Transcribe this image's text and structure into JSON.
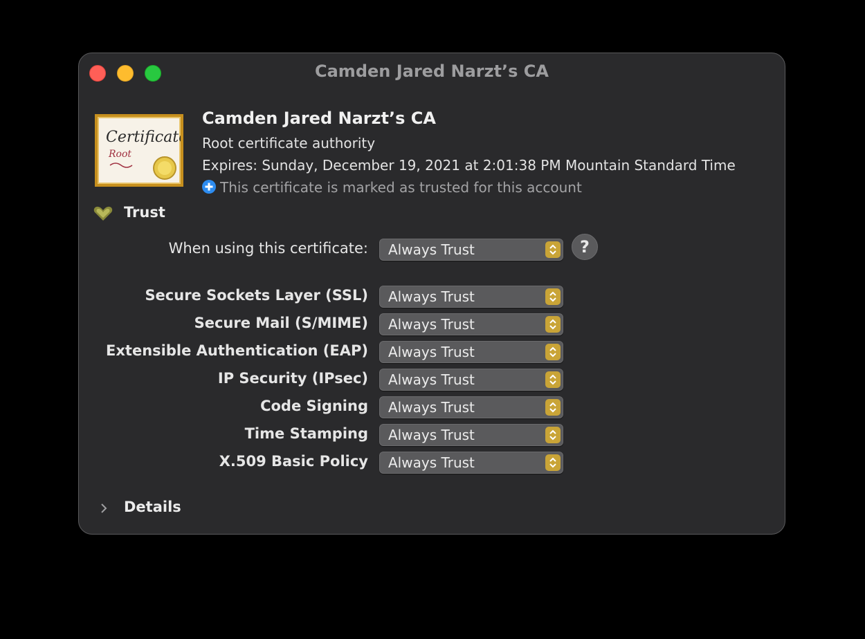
{
  "window": {
    "title": "Camden Jared Narzt’s CA"
  },
  "certificate": {
    "name": "Camden Jared Narzt’s CA",
    "kind": "Root certificate authority",
    "expires": "Expires: Sunday, December 19, 2021 at 2:01:38 PM Mountain Standard Time",
    "status": "This certificate is marked as trusted for this account",
    "icon_title": "Certificate",
    "icon_subtitle": "Root"
  },
  "trust": {
    "section_label": "Trust",
    "when_using": {
      "label": "When using this certificate:",
      "value": "Always Trust"
    },
    "help_label": "?",
    "policies": [
      {
        "label": "Secure Sockets Layer (SSL)",
        "value": "Always Trust"
      },
      {
        "label": "Secure Mail (S/MIME)",
        "value": "Always Trust"
      },
      {
        "label": "Extensible Authentication (EAP)",
        "value": "Always Trust"
      },
      {
        "label": "IP Security (IPsec)",
        "value": "Always Trust"
      },
      {
        "label": "Code Signing",
        "value": "Always Trust"
      },
      {
        "label": "Time Stamping",
        "value": "Always Trust"
      },
      {
        "label": "X.509 Basic Policy",
        "value": "Always Trust"
      }
    ]
  },
  "details": {
    "label": "Details"
  },
  "colors": {
    "accent_gold": "#c9a437",
    "status_blue": "#2d8cf0",
    "window_bg": "#2a2a2c"
  },
  "icons": {
    "status": "plus-circle-icon",
    "trust": "heart-icon",
    "details": "chevron-right-icon",
    "stepper": "up-down-chevron-icon"
  }
}
